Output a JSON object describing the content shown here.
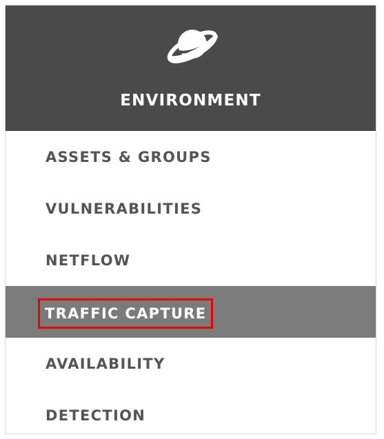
{
  "header": {
    "icon": "planet-icon",
    "title": "ENVIRONMENT"
  },
  "menu": {
    "items": [
      {
        "label": "ASSETS & GROUPS",
        "active": false
      },
      {
        "label": "VULNERABILITIES",
        "active": false
      },
      {
        "label": "NETFLOW",
        "active": false
      },
      {
        "label": "TRAFFIC CAPTURE",
        "active": true
      },
      {
        "label": "AVAILABILITY",
        "active": false
      },
      {
        "label": "DETECTION",
        "active": false
      }
    ]
  },
  "colors": {
    "header_bg": "#4a4a4a",
    "active_bg": "#7b7b7b",
    "highlight_border": "#e60000",
    "item_text": "#555555",
    "white": "#ffffff"
  }
}
